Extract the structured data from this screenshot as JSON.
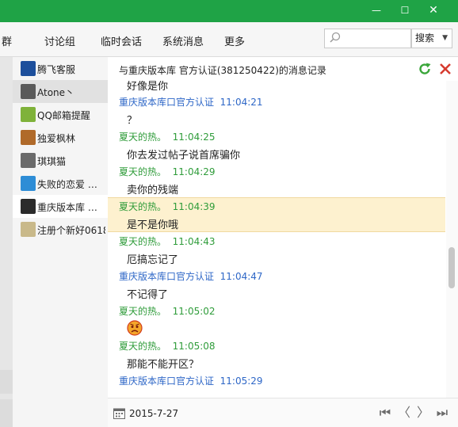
{
  "window": {
    "minimize_glyph": "—",
    "maximize_glyph": "☐",
    "close_glyph": "✕"
  },
  "tabs": [
    {
      "label": "群"
    },
    {
      "label": "讨论组"
    },
    {
      "label": "临时会话"
    },
    {
      "label": "系统消息"
    },
    {
      "label": "更多"
    }
  ],
  "search": {
    "value": "",
    "button_label": "搜索",
    "caret": "▼"
  },
  "contacts": [
    {
      "name": "腾飞客服",
      "avatar_color": "#1d4f9c",
      "selected": false
    },
    {
      "name": "Atone丶",
      "avatar_color": "#5a5a5a",
      "selected": true
    },
    {
      "name": "QQ邮箱提醒",
      "avatar_color": "#7fb23a",
      "selected": false
    },
    {
      "name": "独爱枫林",
      "avatar_color": "#b06a2a",
      "selected": false
    },
    {
      "name": "琪琪猫",
      "avatar_color": "#6b6b6b",
      "selected": false
    },
    {
      "name": "失败的恋爱 …",
      "avatar_color": "#2e8dd6",
      "selected": false
    },
    {
      "name": "重庆版本库 …",
      "avatar_color": "#2b2b2b",
      "selected": false,
      "current": true
    },
    {
      "name": "注册个新好0618",
      "avatar_color": "#c9b98a",
      "selected": false
    }
  ],
  "chat": {
    "title": "与重庆版本库  官方认证(381250422)的消息记录",
    "partial_top_text": "好像是你",
    "messages": [
      {
        "sender": "重庆版本库口官方认证",
        "time": "11:04:21",
        "color": "blue",
        "text": "？"
      },
      {
        "sender": "夏天的热。",
        "time": "11:04:25",
        "color": "green",
        "text": "你去发过帖子说首席骗你"
      },
      {
        "sender": "夏天的热。",
        "time": "11:04:29",
        "color": "green",
        "text": "卖你的残端"
      },
      {
        "sender": "夏天的热。",
        "time": "11:04:39",
        "color": "green",
        "text": "是不是你哦",
        "highlighted": true
      },
      {
        "sender": "夏天的热。",
        "time": "11:04:43",
        "color": "green",
        "text": "厄搞忘记了"
      },
      {
        "sender": "重庆版本库口官方认证",
        "time": "11:04:47",
        "color": "blue",
        "text": "不记得了"
      },
      {
        "sender": "夏天的热。",
        "time": "11:05:02",
        "color": "green",
        "text": "",
        "emoji": "angry-face"
      },
      {
        "sender": "夏天的热。",
        "time": "11:05:08",
        "color": "green",
        "text": "那能不能开区？"
      },
      {
        "sender": "重庆版本库口官方认证",
        "time": "11:05:29",
        "color": "blue",
        "text": ""
      }
    ]
  },
  "footer": {
    "date": "2015-7-27",
    "first_glyph": "⏮",
    "prev_glyph": "〈",
    "next_glyph": "〉",
    "last_glyph": "⏭"
  },
  "colors": {
    "titlebar": "#1fa346",
    "green_sender": "#2f9c3a",
    "blue_sender": "#2e67c7",
    "highlight": "#fdf1cf"
  }
}
